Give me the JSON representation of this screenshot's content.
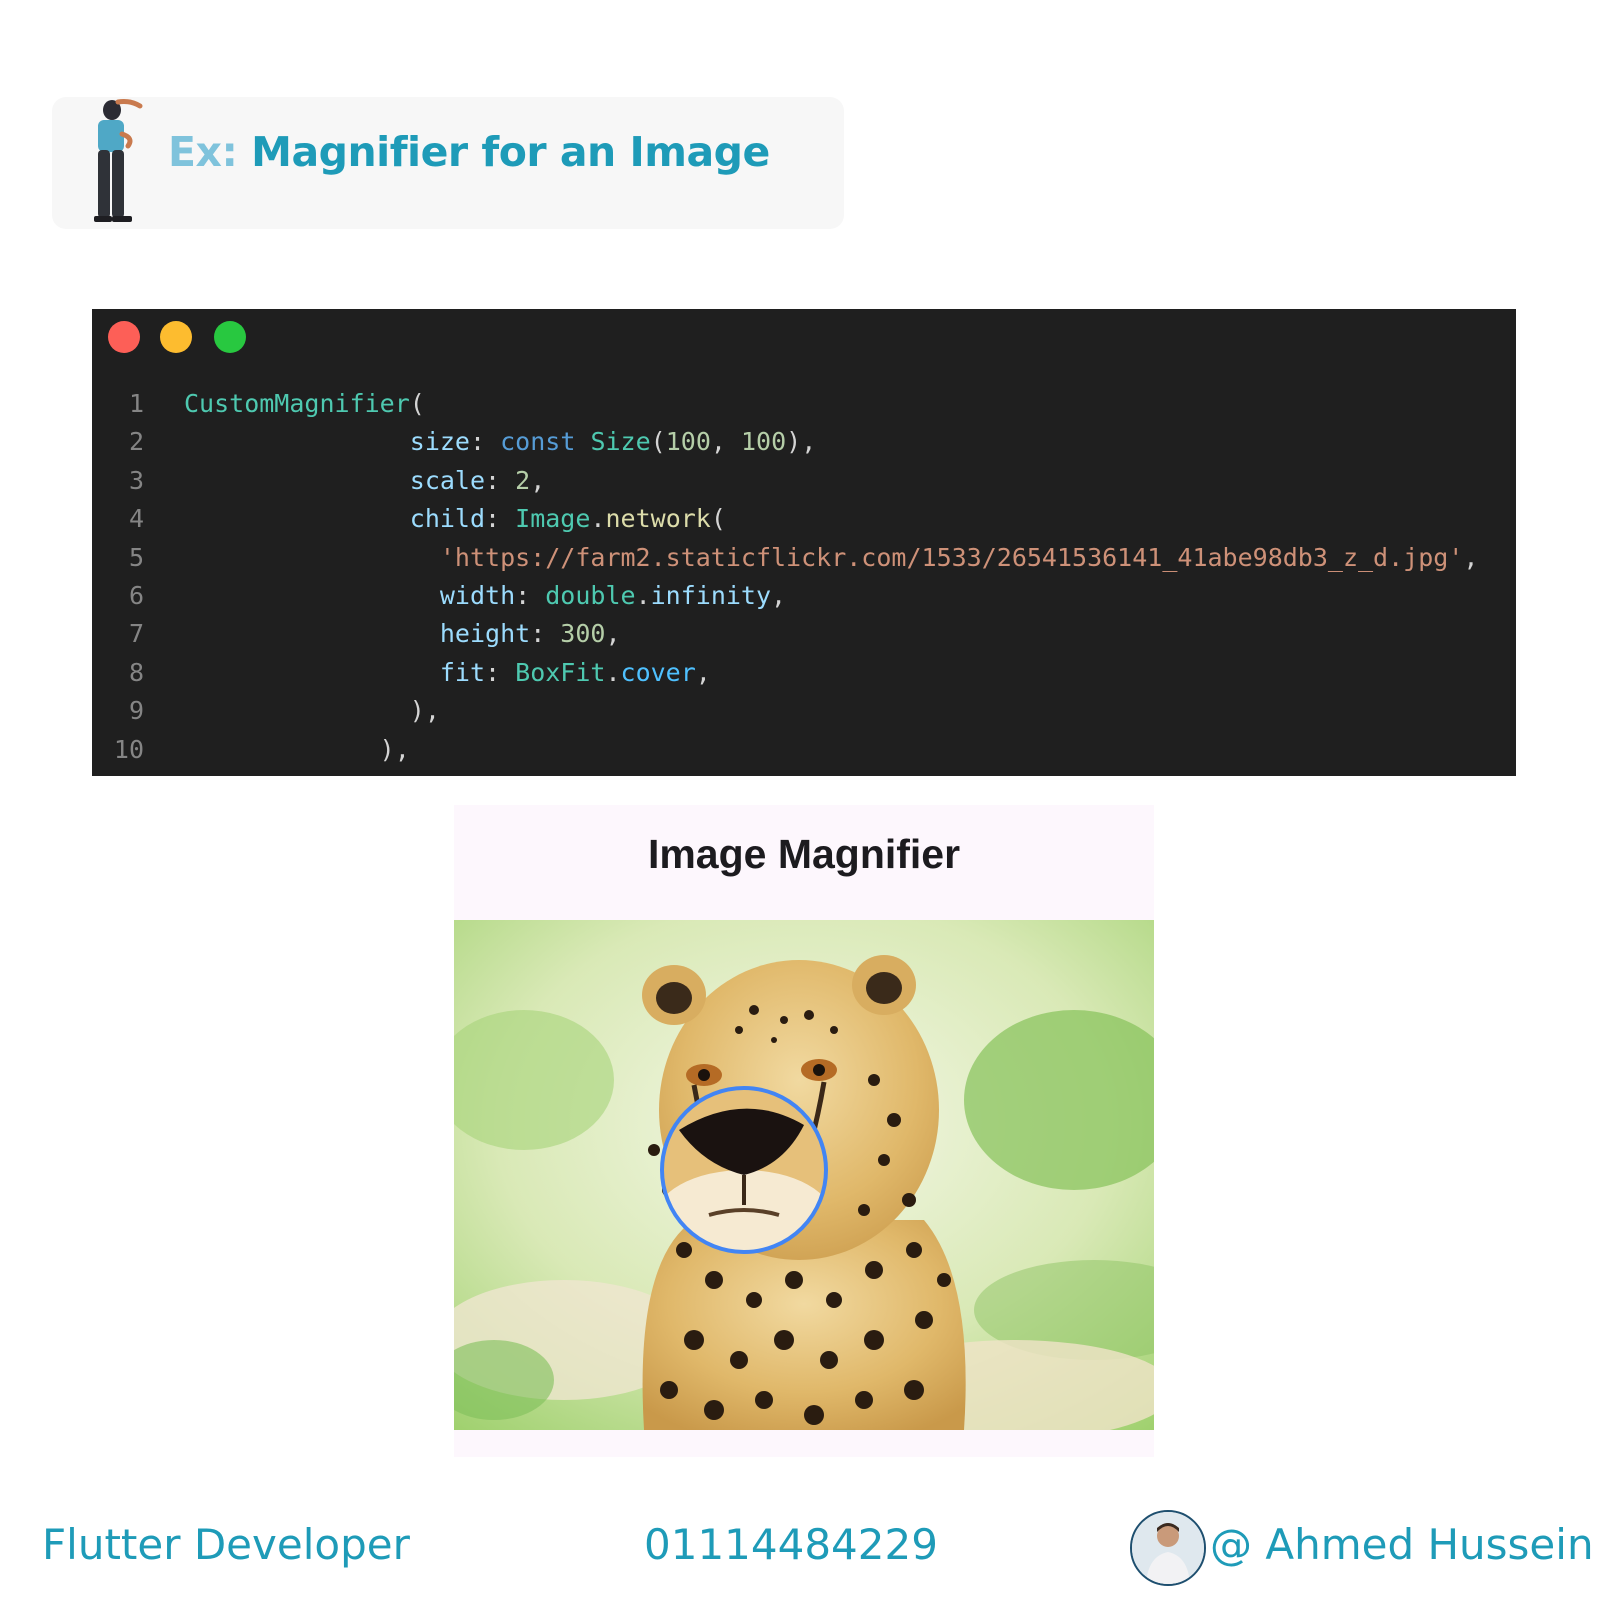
{
  "header": {
    "prefix": "Ex:",
    "title": "Magnifier for an Image"
  },
  "code_window": {
    "lines": [
      {
        "number": "1",
        "indent": "",
        "tokens": [
          {
            "t": "cls",
            "v": "CustomMagnifier"
          },
          {
            "t": "punc",
            "v": "("
          }
        ]
      },
      {
        "number": "2",
        "indent": "               ",
        "tokens": [
          {
            "t": "prop",
            "v": "size"
          },
          {
            "t": "punc",
            "v": ": "
          },
          {
            "t": "kw",
            "v": "const"
          },
          {
            "t": "punc",
            "v": " "
          },
          {
            "t": "cls",
            "v": "Size"
          },
          {
            "t": "punc",
            "v": "("
          },
          {
            "t": "num",
            "v": "100"
          },
          {
            "t": "punc",
            "v": ", "
          },
          {
            "t": "num",
            "v": "100"
          },
          {
            "t": "punc",
            "v": "),"
          }
        ]
      },
      {
        "number": "3",
        "indent": "               ",
        "tokens": [
          {
            "t": "prop",
            "v": "scale"
          },
          {
            "t": "punc",
            "v": ": "
          },
          {
            "t": "num",
            "v": "2"
          },
          {
            "t": "punc",
            "v": ","
          }
        ]
      },
      {
        "number": "4",
        "indent": "               ",
        "tokens": [
          {
            "t": "prop",
            "v": "child"
          },
          {
            "t": "punc",
            "v": ": "
          },
          {
            "t": "cls",
            "v": "Image"
          },
          {
            "t": "punc",
            "v": "."
          },
          {
            "t": "method",
            "v": "network"
          },
          {
            "t": "punc",
            "v": "("
          }
        ]
      },
      {
        "number": "5",
        "indent": "                 ",
        "tokens": [
          {
            "t": "str",
            "v": "'https://farm2.staticflickr.com/1533/26541536141_41abe98db3_z_d.jpg'"
          },
          {
            "t": "punc",
            "v": ","
          }
        ]
      },
      {
        "number": "6",
        "indent": "                 ",
        "tokens": [
          {
            "t": "prop",
            "v": "width"
          },
          {
            "t": "punc",
            "v": ": "
          },
          {
            "t": "cls",
            "v": "double"
          },
          {
            "t": "punc",
            "v": "."
          },
          {
            "t": "prop",
            "v": "infinity"
          },
          {
            "t": "punc",
            "v": ","
          }
        ]
      },
      {
        "number": "7",
        "indent": "                 ",
        "tokens": [
          {
            "t": "prop",
            "v": "height"
          },
          {
            "t": "punc",
            "v": ": "
          },
          {
            "t": "num",
            "v": "300"
          },
          {
            "t": "punc",
            "v": ","
          }
        ]
      },
      {
        "number": "8",
        "indent": "                 ",
        "tokens": [
          {
            "t": "prop",
            "v": "fit"
          },
          {
            "t": "punc",
            "v": ": "
          },
          {
            "t": "cls",
            "v": "BoxFit"
          },
          {
            "t": "punc",
            "v": "."
          },
          {
            "t": "enum",
            "v": "cover"
          },
          {
            "t": "punc",
            "v": ","
          }
        ]
      },
      {
        "number": "9",
        "indent": "               ",
        "tokens": [
          {
            "t": "punc",
            "v": "),"
          }
        ]
      },
      {
        "number": "10",
        "indent": "             ",
        "tokens": [
          {
            "t": "punc",
            "v": "),"
          }
        ]
      }
    ]
  },
  "app_preview": {
    "title": "Image Magnifier"
  },
  "footer": {
    "role": "Flutter Developer",
    "phone": "01114484229",
    "handle": "@ Ahmed Hussein"
  },
  "colors": {
    "accent": "#1e9bb8",
    "accent_light": "#7fc3dc",
    "code_bg": "#1f1f1f",
    "magnifier_ring": "#4285f4"
  }
}
